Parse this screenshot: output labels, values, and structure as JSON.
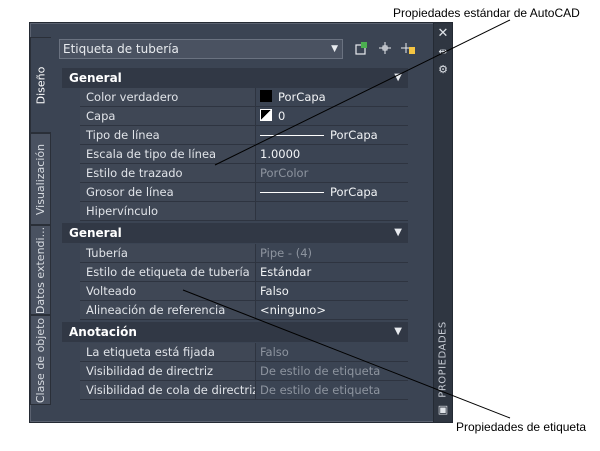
{
  "callouts": {
    "top": "Propiedades estándar de AutoCAD",
    "bottom": "Propiedades de etiqueta"
  },
  "left_tabs": [
    {
      "label": "Diseño",
      "active": true
    },
    {
      "label": "Visualización",
      "active": false
    },
    {
      "label": "Datos extendi...",
      "active": false
    },
    {
      "label": "Clase de objeto",
      "active": false
    }
  ],
  "titlebar": {
    "title": "PROPIEDADES",
    "icons": [
      "close-icon",
      "autohide-icon",
      "properties-menu-icon",
      "settings-icon"
    ]
  },
  "selector": {
    "value": "Etiqueta de tubería",
    "tools": [
      "quick-select-icon",
      "select-objects-icon",
      "toggle-pickadd-icon"
    ]
  },
  "sections": [
    {
      "title": "General",
      "rows": [
        {
          "name": "Color verdadero",
          "value": "PorCapa",
          "swatch": "color",
          "readonly": false
        },
        {
          "name": "Capa",
          "value": "0",
          "swatch": "layer",
          "readonly": false
        },
        {
          "name": "Tipo de línea",
          "value": "PorCapa",
          "swatch": "line",
          "readonly": false
        },
        {
          "name": "Escala de tipo de línea",
          "value": "1.0000",
          "swatch": "",
          "readonly": false
        },
        {
          "name": "Estilo de trazado",
          "value": "PorColor",
          "swatch": "",
          "readonly": true
        },
        {
          "name": "Grosor de línea",
          "value": "PorCapa",
          "swatch": "line",
          "readonly": false
        },
        {
          "name": "Hipervínculo",
          "value": "",
          "swatch": "",
          "readonly": false
        }
      ]
    },
    {
      "title": "General",
      "rows": [
        {
          "name": "Tubería",
          "value": "Pipe - (4)",
          "swatch": "",
          "readonly": true
        },
        {
          "name": "Estilo de etiqueta de tubería",
          "value": "Estándar",
          "swatch": "",
          "readonly": false
        },
        {
          "name": "Volteado",
          "value": "Falso",
          "swatch": "",
          "readonly": false
        },
        {
          "name": "Alineación de referencia",
          "value": "<ninguno>",
          "swatch": "",
          "readonly": false
        }
      ]
    },
    {
      "title": "Anotación",
      "rows": [
        {
          "name": "La etiqueta está fijada",
          "value": "Falso",
          "swatch": "",
          "readonly": true
        },
        {
          "name": "Visibilidad de directriz",
          "value": "De estilo de etiqueta",
          "swatch": "",
          "readonly": true
        },
        {
          "name": "Visibilidad de cola de directriz",
          "value": "De estilo de etiqueta",
          "swatch": "",
          "readonly": true
        }
      ]
    }
  ]
}
